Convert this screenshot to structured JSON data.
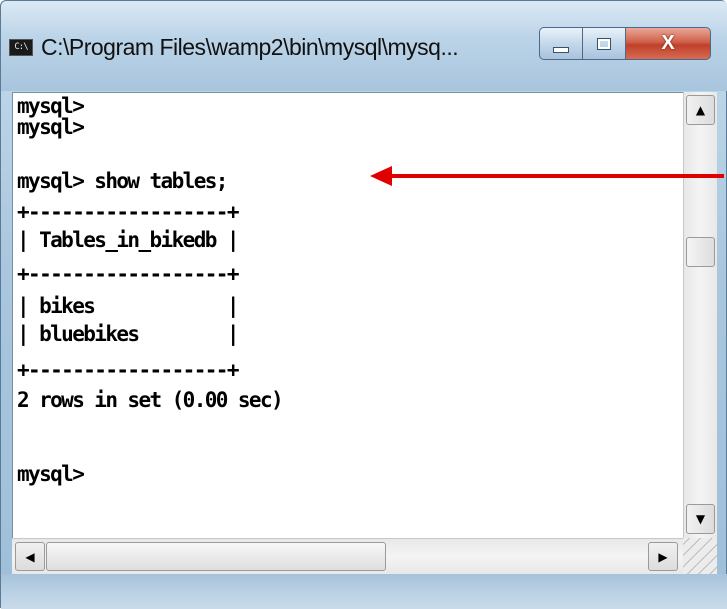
{
  "window": {
    "title": "C:\\Program Files\\wamp2\\bin\\mysql\\mysq...",
    "icon": "console-icon",
    "icon_text": "C:\\",
    "controls": [
      "minimize",
      "maximize",
      "close"
    ],
    "close_label": "X"
  },
  "console": {
    "lines": [
      "mysql>",
      "mysql>",
      "mysql> show tables;",
      "+------------------+",
      "| Tables_in_bikedb |",
      "+------------------+",
      "| bikes            |",
      "| bluebikes        |",
      "+------------------+",
      "2 rows in set (0.00 sec)",
      "",
      "mysql>"
    ]
  },
  "scrollbars": {
    "up_glyph": "▲",
    "down_glyph": "▼",
    "left_glyph": "◀",
    "right_glyph": "▶"
  },
  "annotation": {
    "color": "#e00000",
    "points_to": "mysql> show tables;"
  },
  "colors": {
    "console_bg": "#ffffff",
    "console_text": "#000000",
    "titlebar": "#bcd4e8",
    "close_button": "#c0412b"
  }
}
